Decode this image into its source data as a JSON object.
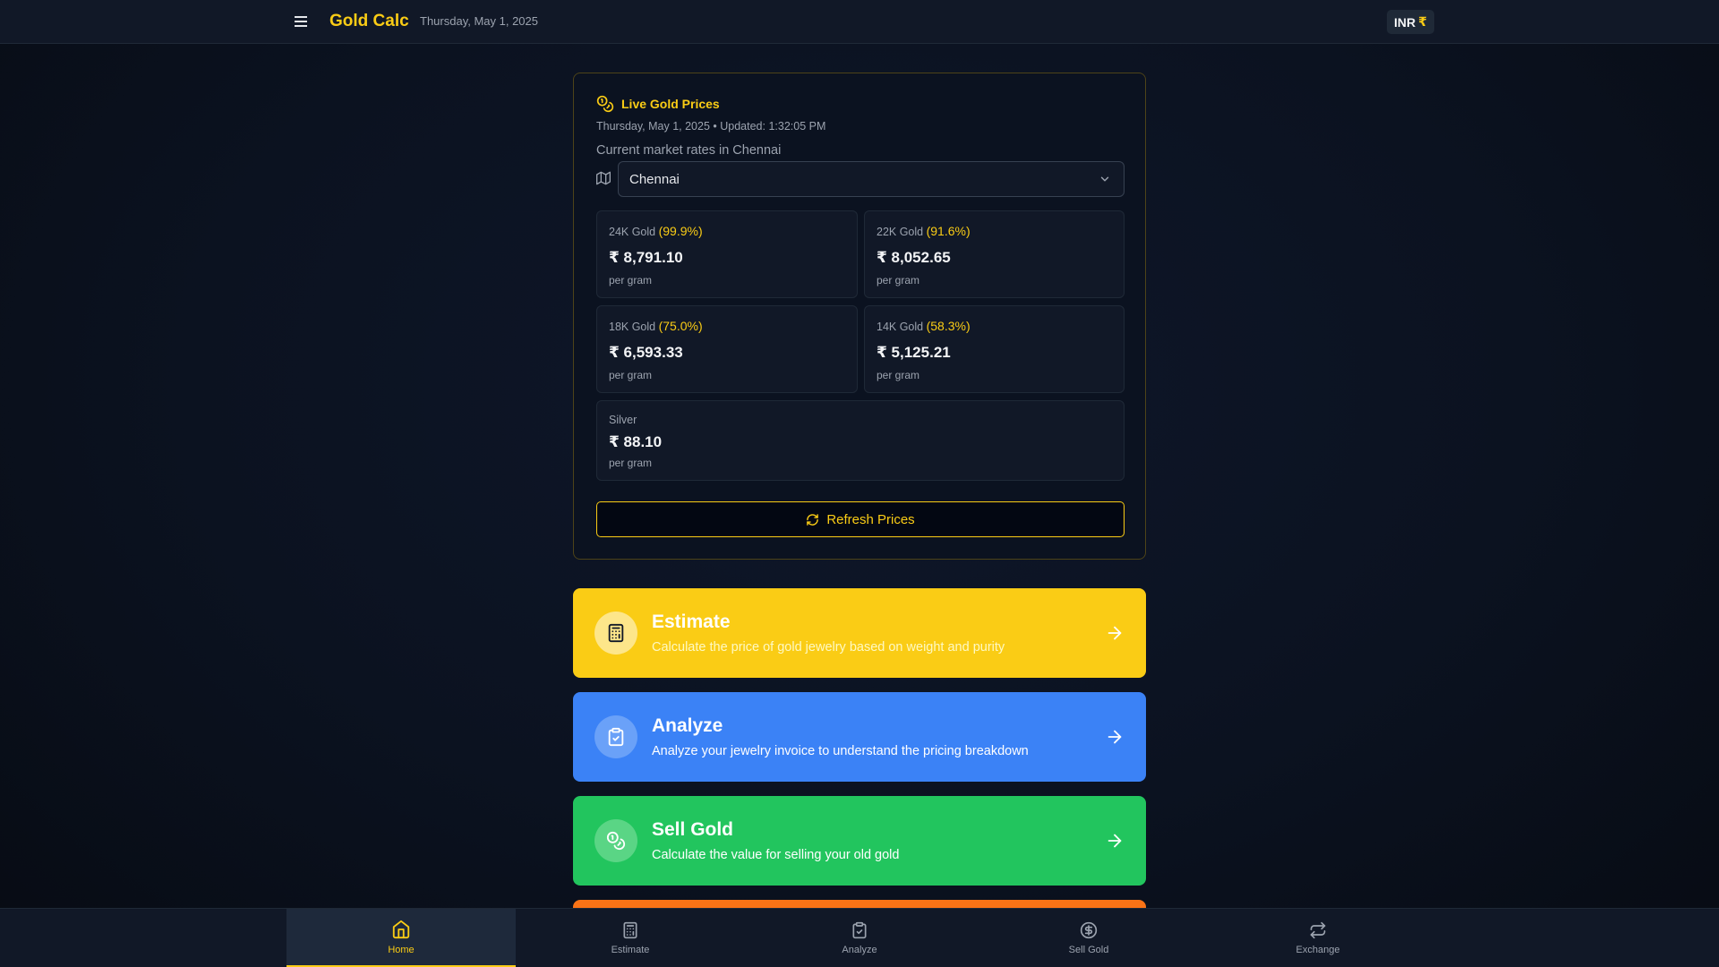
{
  "header": {
    "brand": "Gold Calc",
    "date": "Thursday, May 1, 2025",
    "currency_code": "INR",
    "currency_symbol": "₹",
    "menu_icon": "hamburger-menu-icon"
  },
  "prices": {
    "title": "Live Gold Prices",
    "updated": "Thursday, May 1, 2025 • Updated: 1:32:05 PM",
    "description": "Current market rates in Chennai",
    "city": "Chennai",
    "tiles": [
      {
        "label": "24K Gold",
        "purity": "(99.9%)",
        "price": "₹ 8,791.10",
        "unit": "per gram"
      },
      {
        "label": "22K Gold",
        "purity": "(91.6%)",
        "price": "₹ 8,052.65",
        "unit": "per gram"
      },
      {
        "label": "18K Gold",
        "purity": "(75.0%)",
        "price": "₹ 6,593.33",
        "unit": "per gram"
      },
      {
        "label": "14K Gold",
        "purity": "(58.3%)",
        "price": "₹ 5,125.21",
        "unit": "per gram"
      }
    ],
    "silver": {
      "label": "Silver",
      "price": "₹ 88.10",
      "unit": "per gram"
    },
    "refresh_label": "Refresh Prices"
  },
  "actions": [
    {
      "title": "Estimate",
      "desc": "Calculate the price of gold jewelry based on weight and purity",
      "icon": "calculator-icon",
      "color": "#facc15"
    },
    {
      "title": "Analyze",
      "desc": "Analyze your jewelry invoice to understand the pricing breakdown",
      "icon": "clipboard-check-icon",
      "color": "#3b82f6"
    },
    {
      "title": "Sell Gold",
      "desc": "Calculate the value for selling your old gold",
      "icon": "coins-icon",
      "color": "#22c55e"
    }
  ],
  "nav": [
    {
      "label": "Home",
      "icon": "home-icon",
      "active": true
    },
    {
      "label": "Estimate",
      "icon": "calculator-icon",
      "active": false
    },
    {
      "label": "Analyze",
      "icon": "clipboard-check-icon",
      "active": false
    },
    {
      "label": "Sell Gold",
      "icon": "dollar-circle-icon",
      "active": false
    },
    {
      "label": "Exchange",
      "icon": "repeat-icon",
      "active": false
    }
  ],
  "colors": {
    "accent": "#facc15",
    "background": "#0b1220",
    "panel": "#111827"
  }
}
